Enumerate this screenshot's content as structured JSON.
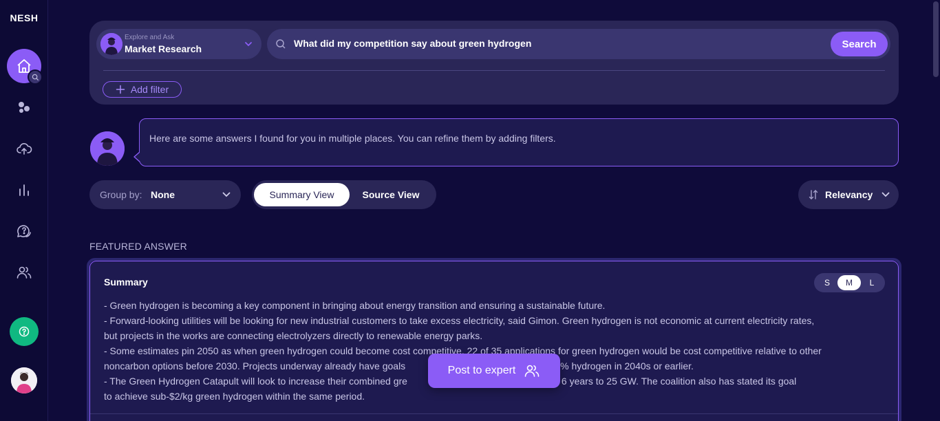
{
  "app": {
    "logo": "NESH"
  },
  "sidebar": {
    "items": [
      {
        "name": "home",
        "icon": "home-icon"
      },
      {
        "name": "insights",
        "icon": "bubbles-icon"
      },
      {
        "name": "upload",
        "icon": "cloud-upload-icon"
      },
      {
        "name": "analytics",
        "icon": "bar-chart-icon"
      },
      {
        "name": "questions",
        "icon": "chat-question-icon"
      },
      {
        "name": "users",
        "icon": "users-icon"
      }
    ],
    "help_icon": "help-icon",
    "user_avatar": "user-avatar"
  },
  "search": {
    "context_sub": "Explore and Ask",
    "context_main": "Market Research",
    "query": "What did my competition say about green hydrogen",
    "button_label": "Search",
    "add_filter_label": "Add filter"
  },
  "bot": {
    "message": "Here are some answers I found for you in multiple places. You can refine them by adding filters."
  },
  "controls": {
    "group_by_label": "Group by:",
    "group_by_value": "None",
    "views": [
      "Summary View",
      "Source View"
    ],
    "active_view": "Summary View",
    "sort_label": "Relevancy"
  },
  "featured": {
    "section_label": "FEATURED ANSWER",
    "title": "Summary",
    "sizes": [
      "S",
      "M",
      "L"
    ],
    "active_size": "M",
    "lines": [
      "- Green hydrogen is becoming a key component in bringing about energy transition and ensuring a sustainable future.",
      "- Forward-looking utilities will be looking for new industrial customers to take excess electricity, said Gimon. Green hydrogen is not economic at current electricity rates,",
      "but projects in the works are connecting electrolyzers directly to renewable energy parks.",
      "- Some estimates pin 2050 as when green hydrogen could become cost competitive. 22 of 35 applications for green hydrogen would be cost competitive relative to other",
      "noncarbon options before 2030. Projects underway already have goals",
      "to 100% hydrogen in 2040s or earlier.",
      "- The Green Hydrogen Catapult will look to increase their combined gre",
      "fold in the next 6 years to 25 GW. The coalition also has stated its goal",
      "to achieve sub-$2/kg green hydrogen within the same period."
    ]
  },
  "post_expert": {
    "label": "Post to expert"
  },
  "colors": {
    "background": "#0f0b3a",
    "accent": "#8b5cf6",
    "card": "#2a2657",
    "help": "#10b981"
  }
}
